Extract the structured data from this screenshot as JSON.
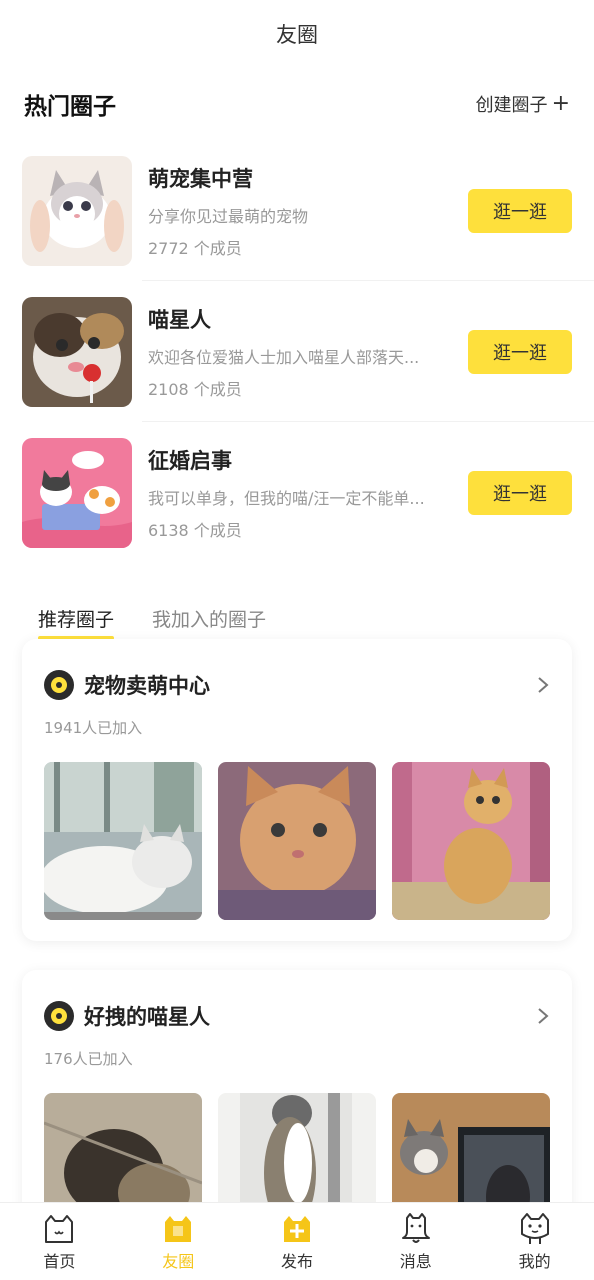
{
  "header": {
    "title": "友圈"
  },
  "hot": {
    "heading": "热门圈子",
    "create_label": "创建圈子",
    "create_icon": "plus-icon",
    "items": [
      {
        "name": "萌宠集中营",
        "desc": "分享你见过最萌的宠物",
        "members": "2772 个成员",
        "button": "逛一逛"
      },
      {
        "name": "喵星人",
        "desc": "欢迎各位爱猫人士加入喵星人部落天...",
        "members": "2108 个成员",
        "button": "逛一逛"
      },
      {
        "name": "征婚启事",
        "desc": "我可以单身，但我的喵/汪一定不能单...",
        "members": "6138 个成员",
        "button": "逛一逛"
      }
    ]
  },
  "tabs": [
    {
      "label": "推荐圈子",
      "active": true
    },
    {
      "label": "我加入的圈子",
      "active": false
    }
  ],
  "cards": [
    {
      "title": "宠物卖萌中心",
      "joined": "1941人已加入"
    },
    {
      "title": "好拽的喵星人",
      "joined": "176人已加入"
    }
  ],
  "nav": [
    {
      "label": "首页",
      "icon": "cat-home-icon",
      "active": false
    },
    {
      "label": "友圈",
      "icon": "friends-circle-icon",
      "active": true
    },
    {
      "label": "发布",
      "icon": "publish-plus-icon",
      "active": false
    },
    {
      "label": "消息",
      "icon": "message-bell-icon",
      "active": false
    },
    {
      "label": "我的",
      "icon": "profile-cat-icon",
      "active": false
    }
  ],
  "colors": {
    "accent": "#FEE03C",
    "active_nav": "#F5C518",
    "muted_text": "#999999"
  }
}
